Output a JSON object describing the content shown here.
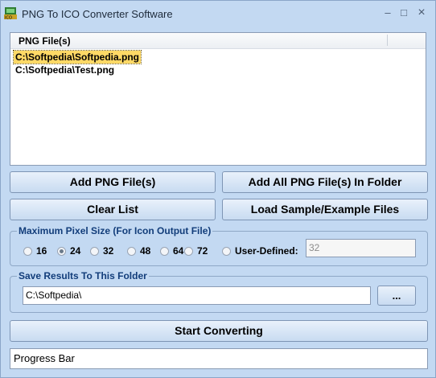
{
  "window": {
    "title": "PNG To ICO Converter Software",
    "controls": {
      "minimize": "–",
      "maximize": "□",
      "close": "×"
    }
  },
  "file_list": {
    "column_header": "PNG File(s)",
    "items": [
      "C:\\Softpedia\\Softpedia.png",
      "C:\\Softpedia\\Test.png"
    ],
    "selected_index": 0
  },
  "buttons": {
    "add_png": "Add PNG File(s)",
    "add_all": "Add All PNG File(s) In Folder",
    "clear_list": "Clear List",
    "load_sample": "Load Sample/Example Files",
    "start": "Start Converting",
    "browse": "..."
  },
  "pixel_size": {
    "title": "Maximum Pixel Size (For Icon Output File)",
    "options": [
      "16",
      "24",
      "32",
      "48",
      "64",
      "72",
      "User-Defined:"
    ],
    "selected": "24",
    "user_defined_value": "32"
  },
  "save_folder": {
    "title": "Save Results To This Folder",
    "path": "C:\\Softpedia\\"
  },
  "progress": {
    "label": "Progress Bar"
  }
}
